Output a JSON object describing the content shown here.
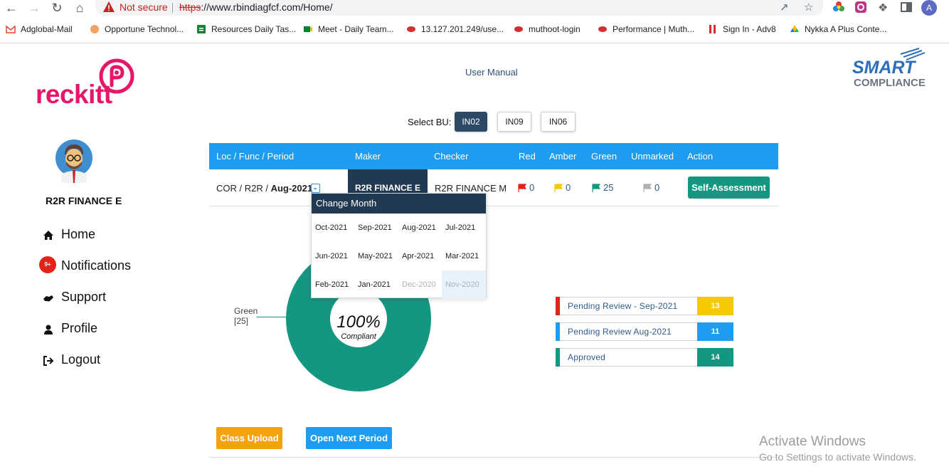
{
  "browser": {
    "security_label": "Not secure",
    "url_protocol": "https",
    "url_rest": "://www.rbindiagfcf.com/Home/",
    "profile_initial": "A",
    "bookmarks": [
      {
        "label": "Adglobal-Mail",
        "icon": "gmail-icon"
      },
      {
        "label": "Opportune Technol...",
        "icon": "opportune-icon"
      },
      {
        "label": "Resources Daily Tas...",
        "icon": "sheets-icon"
      },
      {
        "label": "Meet - Daily Team...",
        "icon": "meet-icon"
      },
      {
        "label": "13.127.201.249/use...",
        "icon": "muthoot-icon"
      },
      {
        "label": "muthoot-login",
        "icon": "muthoot-icon"
      },
      {
        "label": "Performance | Muth...",
        "icon": "muthoot-icon"
      },
      {
        "label": "Sign In - Adv8",
        "icon": "adv8-icon"
      },
      {
        "label": "Nykka A Plus Conte...",
        "icon": "drive-icon"
      }
    ]
  },
  "header": {
    "brand_left": "reckitt",
    "user_manual": "User Manual",
    "brand_right_top": "SMART",
    "brand_right_bottom": "COMPLIANCE"
  },
  "sidebar": {
    "user_name": "R2R FINANCE E",
    "notifications_badge": "9+",
    "items": [
      {
        "label": "Home",
        "icon": "home-icon"
      },
      {
        "label": "Notifications",
        "icon": "bell-icon"
      },
      {
        "label": "Support",
        "icon": "handshake-icon"
      },
      {
        "label": "Profile",
        "icon": "user-icon"
      },
      {
        "label": "Logout",
        "icon": "logout-icon"
      }
    ]
  },
  "bu": {
    "label": "Select BU:",
    "options": [
      "IN02",
      "IN09",
      "IN06"
    ],
    "selected": "IN02"
  },
  "table": {
    "headers": [
      "Loc / Func / Period",
      "Maker",
      "Checker",
      "Red",
      "Amber",
      "Green",
      "Unmarked",
      "Action"
    ],
    "row": {
      "loc_prefix": "COR / R2R / ",
      "period": "Aug-2021",
      "maker": "R2R FINANCE E",
      "checker": "R2R FINANCE M",
      "red": "0",
      "amber": "0",
      "green": "25",
      "unmarked": "0",
      "action": "Self-Assessment"
    }
  },
  "month_popup": {
    "title": "Change Month",
    "months": [
      {
        "label": "Oct-2021",
        "disabled": false
      },
      {
        "label": "Sep-2021",
        "disabled": false
      },
      {
        "label": "Aug-2021",
        "disabled": false
      },
      {
        "label": "Jul-2021",
        "disabled": false
      },
      {
        "label": "Jun-2021",
        "disabled": false
      },
      {
        "label": "May-2021",
        "disabled": false
      },
      {
        "label": "Apr-2021",
        "disabled": false
      },
      {
        "label": "Mar-2021",
        "disabled": false
      },
      {
        "label": "Feb-2021",
        "disabled": false
      },
      {
        "label": "Jan-2021",
        "disabled": false
      },
      {
        "label": "Dec-2020",
        "disabled": true
      },
      {
        "label": "Nov-2020",
        "disabled": true
      }
    ]
  },
  "donut": {
    "center_value": "100%",
    "center_label": "Compliant",
    "legend_label": "Green",
    "legend_value": "[25]",
    "green_fraction": 1.0,
    "color": "#159680"
  },
  "status": [
    {
      "label": "Pending Review - Sep-2021",
      "count": "13",
      "color": "#f5c800",
      "bar": "#e2231a"
    },
    {
      "label": "Pending Review Aug-2021",
      "count": "11",
      "color": "#1e9cf0",
      "bar": "#1e9cf0"
    },
    {
      "label": "Approved",
      "count": "14",
      "color": "#159680",
      "bar": "#159680"
    }
  ],
  "buttons": {
    "class_upload": "Class Upload",
    "open_next_period": "Open Next Period"
  },
  "watermark": {
    "line1": "Activate Windows",
    "line2": "Go to Settings to activate Windows."
  }
}
